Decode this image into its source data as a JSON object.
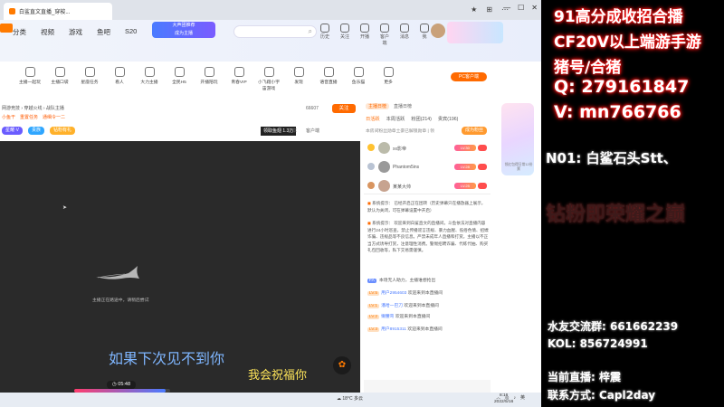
{
  "browser": {
    "tab_title": "白鲨直文直播_穿梭...",
    "toolbar_icons": [
      "star-icon",
      "extension-icon",
      "menu-icon"
    ]
  },
  "site": {
    "nav": [
      "分类",
      "视频",
      "游戏",
      "鱼吧",
      "S20"
    ],
    "search_placeholder": "",
    "promo": [
      "大声团推荐",
      "成为主播"
    ],
    "user_actions": [
      "历史",
      "关注",
      "开播",
      "客户端",
      "消息",
      "我"
    ]
  },
  "categories": [
    "主播一起玩",
    "主播口袋",
    "星座任务",
    "看人",
    "大力主播",
    "全民H5",
    "开播陪玩",
    "青春VIP",
    "小飞翔小宇宙游戏",
    "发现",
    "语音直播",
    "鱼乐猫",
    "更多"
  ],
  "pc_button": "PC客户端",
  "room": {
    "title": "网游竞技 › 穿越火线 › 战队主播",
    "tags": [
      "小鱼干",
      "重置任务",
      "通缉令一二"
    ],
    "badges": [
      "星耀·V",
      "贵族",
      "钻粉有礼"
    ],
    "follow_count": "66607",
    "follow_label": "关注",
    "boss_tag": "领取鱼翅 1.3万",
    "share_labels": [
      "分享",
      "客户端"
    ]
  },
  "player": {
    "offline_text": "主播正在路途中，请稍后尝试",
    "subtitle_1": "如果下次见不到你",
    "subtitle_2": "我会祝福你",
    "time": "05:48",
    "progress": 0.95
  },
  "chat": {
    "tabs": [
      "日活跃",
      "本周活跃",
      "粉团(214)",
      "贵宾(196)"
    ],
    "rank_tabs": [
      "主播日榜",
      "直播日榜"
    ],
    "pin_notice": "本房间粉丝勋章土豪已解锁勋章 | 领",
    "open_guard": "成为粉丝",
    "rank": [
      {
        "name": "xx影帝",
        "level": "LV.30"
      },
      {
        "name": "Phantom5ins",
        "level": "LV.28"
      },
      {
        "name": "某某大帅",
        "level": "LV.25"
      }
    ],
    "system_msg_1": "系统提示： 已经开启正在团转（历史弹幕只在播放器上展示，默认为关闭，可在弹幕设置中开启）",
    "system_msg_2": "系统提示： 欢迎来到白鲨直文的直播间。斗鱼依法对直播内容进行24小时巡查，禁止传播谣言违规、暴力血腥、低俗色情、招嫖诈骗、违规品等不良信息。严禁未成年人直播和打赏。主播以不正当方式诱导打赏，注意理性消费。警惕招聘诈骗、代练代抽、购买礼包回收等，私下交易需谨慎。",
    "fans_row": "本场无人助力，主播谁想抢出",
    "welcomes": [
      {
        "level": "LV.5",
        "user": "用户2954603",
        "text": "欢迎来到本直播间"
      },
      {
        "level": "LV.1",
        "user": "潘哈一巴刀",
        "text": "欢迎来到本直播间"
      },
      {
        "level": "LV.2",
        "user": "懒腰弯",
        "text": "欢迎来到本直播间"
      },
      {
        "level": "LV.3",
        "user": "用户8915311",
        "text": "欢迎来到本直播间"
      }
    ]
  },
  "side_ad": "领红包得日常12份票",
  "taskbar": {
    "weather": "18°C 多云",
    "time": "8:16",
    "date": "2022/5/16",
    "lang": "英"
  },
  "overlay": {
    "line1": "91高分成收招合播",
    "line2": "CF20V以上端游手游",
    "line3": "猪号/合猪",
    "line4": "Q: 279161847",
    "line5": "V: mn766766",
    "line6": "N01: 白鲨石头Stt、",
    "watermark": "钻粉即荣耀之巅",
    "qq_group": "水友交流群: 661662239",
    "kol": "KOL: 856724991",
    "current_anchor": "当前直播: 梓震",
    "contact": "联系方式: Capl2day"
  },
  "colors": {
    "accent": "#ff6a00",
    "overlay_glow": "#ff2020"
  }
}
